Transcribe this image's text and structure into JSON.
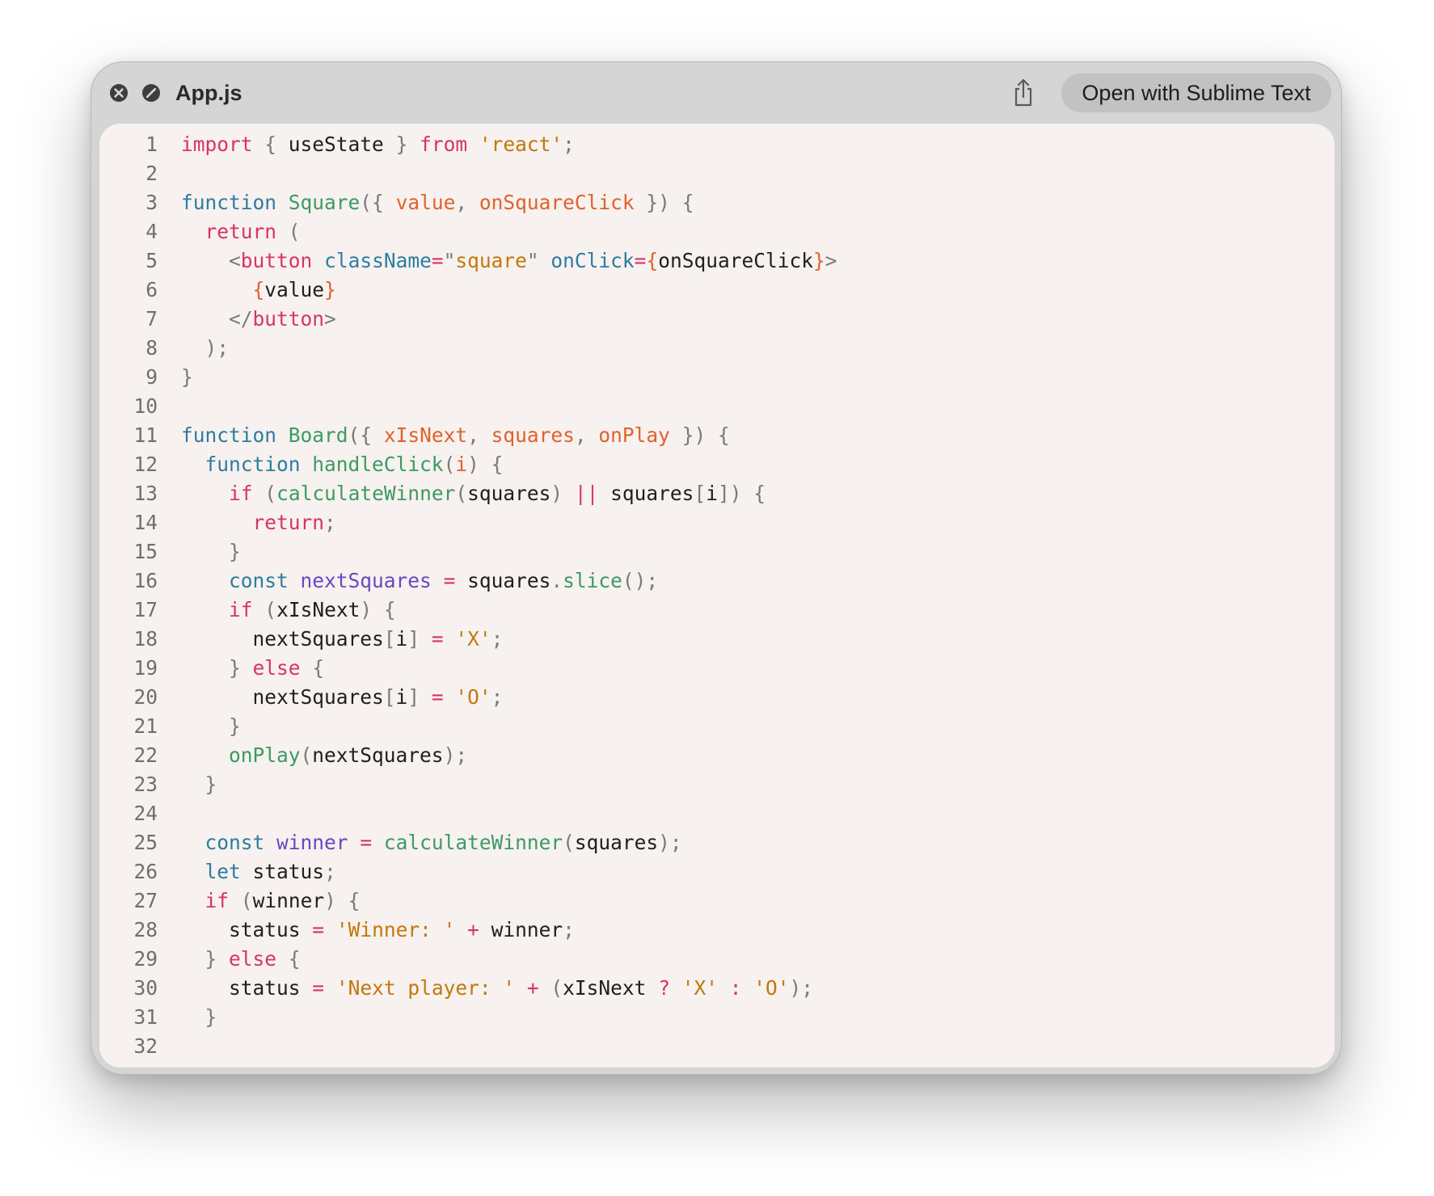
{
  "window": {
    "title": "App.js",
    "open_button_label": "Open with Sublime Text",
    "icons": {
      "close": "close-circle-icon",
      "stop": "stop-circle-icon",
      "share": "share-icon"
    }
  },
  "theme": {
    "titlebar": "#d5d5d5",
    "code_background": "#f7f1ef",
    "line_number": "#6f6f6f",
    "default_text": "#1f1f1f",
    "keyword": "#d6336c",
    "storage": "#2c7da0",
    "function_name": "#3b9b63",
    "parameter": "#e0622a",
    "string": "#c2780b",
    "punctuation": "#7a7a7a",
    "variable_declared": "#6a46c4"
  },
  "code": {
    "lines": [
      {
        "n": "1",
        "tokens": [
          [
            "import",
            "kw"
          ],
          [
            " ",
            "d"
          ],
          [
            "{",
            "p"
          ],
          [
            " useState ",
            "d"
          ],
          [
            "}",
            "p"
          ],
          [
            " ",
            "d"
          ],
          [
            "from",
            "kw"
          ],
          [
            " ",
            "d"
          ],
          [
            "'react'",
            "str"
          ],
          [
            ";",
            "p"
          ]
        ]
      },
      {
        "n": "2",
        "tokens": []
      },
      {
        "n": "3",
        "tokens": [
          [
            "function",
            "st"
          ],
          [
            " ",
            "d"
          ],
          [
            "Square",
            "fn"
          ],
          [
            "({",
            "p"
          ],
          [
            " ",
            "d"
          ],
          [
            "value",
            "par"
          ],
          [
            ",",
            "p"
          ],
          [
            " ",
            "d"
          ],
          [
            "onSquareClick",
            "par"
          ],
          [
            " ",
            "d"
          ],
          [
            "})",
            "p"
          ],
          [
            " ",
            "d"
          ],
          [
            "{",
            "p"
          ]
        ]
      },
      {
        "n": "4",
        "tokens": [
          [
            "  ",
            "d"
          ],
          [
            "return",
            "kw"
          ],
          [
            " ",
            "d"
          ],
          [
            "(",
            "p"
          ]
        ]
      },
      {
        "n": "5",
        "tokens": [
          [
            "    ",
            "d"
          ],
          [
            "<",
            "p"
          ],
          [
            "button",
            "kw"
          ],
          [
            " ",
            "d"
          ],
          [
            "className",
            "st"
          ],
          [
            "=",
            "kw"
          ],
          [
            "\"",
            "p"
          ],
          [
            "square",
            "str"
          ],
          [
            "\"",
            "p"
          ],
          [
            " ",
            "d"
          ],
          [
            "onClick",
            "st"
          ],
          [
            "=",
            "kw"
          ],
          [
            "{",
            "par"
          ],
          [
            "onSquareClick",
            "d"
          ],
          [
            "}",
            "par"
          ],
          [
            ">",
            "p"
          ]
        ]
      },
      {
        "n": "6",
        "tokens": [
          [
            "      ",
            "d"
          ],
          [
            "{",
            "par"
          ],
          [
            "value",
            "d"
          ],
          [
            "}",
            "par"
          ]
        ]
      },
      {
        "n": "7",
        "tokens": [
          [
            "    ",
            "d"
          ],
          [
            "</",
            "p"
          ],
          [
            "button",
            "kw"
          ],
          [
            ">",
            "p"
          ]
        ]
      },
      {
        "n": "8",
        "tokens": [
          [
            "  ",
            "d"
          ],
          [
            ");",
            "p"
          ]
        ]
      },
      {
        "n": "9",
        "tokens": [
          [
            "}",
            "p"
          ]
        ]
      },
      {
        "n": "10",
        "tokens": []
      },
      {
        "n": "11",
        "tokens": [
          [
            "function",
            "st"
          ],
          [
            " ",
            "d"
          ],
          [
            "Board",
            "fn"
          ],
          [
            "({",
            "p"
          ],
          [
            " ",
            "d"
          ],
          [
            "xIsNext",
            "par"
          ],
          [
            ",",
            "p"
          ],
          [
            " ",
            "d"
          ],
          [
            "squares",
            "par"
          ],
          [
            ",",
            "p"
          ],
          [
            " ",
            "d"
          ],
          [
            "onPlay",
            "par"
          ],
          [
            " ",
            "d"
          ],
          [
            "})",
            "p"
          ],
          [
            " ",
            "d"
          ],
          [
            "{",
            "p"
          ]
        ]
      },
      {
        "n": "12",
        "tokens": [
          [
            "  ",
            "d"
          ],
          [
            "function",
            "st"
          ],
          [
            " ",
            "d"
          ],
          [
            "handleClick",
            "fn"
          ],
          [
            "(",
            "p"
          ],
          [
            "i",
            "par"
          ],
          [
            ")",
            "p"
          ],
          [
            " ",
            "d"
          ],
          [
            "{",
            "p"
          ]
        ]
      },
      {
        "n": "13",
        "tokens": [
          [
            "    ",
            "d"
          ],
          [
            "if",
            "kw"
          ],
          [
            " ",
            "d"
          ],
          [
            "(",
            "p"
          ],
          [
            "calculateWinner",
            "fn"
          ],
          [
            "(",
            "p"
          ],
          [
            "squares",
            "d"
          ],
          [
            ")",
            "p"
          ],
          [
            " ",
            "d"
          ],
          [
            "||",
            "kw"
          ],
          [
            " ",
            "d"
          ],
          [
            "squares",
            "d"
          ],
          [
            "[",
            "p"
          ],
          [
            "i",
            "d"
          ],
          [
            "])",
            "p"
          ],
          [
            " ",
            "d"
          ],
          [
            "{",
            "p"
          ]
        ]
      },
      {
        "n": "14",
        "tokens": [
          [
            "      ",
            "d"
          ],
          [
            "return",
            "kw"
          ],
          [
            ";",
            "p"
          ]
        ]
      },
      {
        "n": "15",
        "tokens": [
          [
            "    ",
            "d"
          ],
          [
            "}",
            "p"
          ]
        ]
      },
      {
        "n": "16",
        "tokens": [
          [
            "    ",
            "d"
          ],
          [
            "const",
            "st"
          ],
          [
            " ",
            "d"
          ],
          [
            "nextSquares",
            "var"
          ],
          [
            " ",
            "d"
          ],
          [
            "=",
            "kw"
          ],
          [
            " ",
            "d"
          ],
          [
            "squares",
            "d"
          ],
          [
            ".",
            "p"
          ],
          [
            "slice",
            "fn"
          ],
          [
            "();",
            "p"
          ]
        ]
      },
      {
        "n": "17",
        "tokens": [
          [
            "    ",
            "d"
          ],
          [
            "if",
            "kw"
          ],
          [
            " ",
            "d"
          ],
          [
            "(",
            "p"
          ],
          [
            "xIsNext",
            "d"
          ],
          [
            ")",
            "p"
          ],
          [
            " ",
            "d"
          ],
          [
            "{",
            "p"
          ]
        ]
      },
      {
        "n": "18",
        "tokens": [
          [
            "      ",
            "d"
          ],
          [
            "nextSquares",
            "d"
          ],
          [
            "[",
            "p"
          ],
          [
            "i",
            "d"
          ],
          [
            "]",
            "p"
          ],
          [
            " ",
            "d"
          ],
          [
            "=",
            "kw"
          ],
          [
            " ",
            "d"
          ],
          [
            "'X'",
            "str"
          ],
          [
            ";",
            "p"
          ]
        ]
      },
      {
        "n": "19",
        "tokens": [
          [
            "    ",
            "d"
          ],
          [
            "}",
            "p"
          ],
          [
            " ",
            "d"
          ],
          [
            "else",
            "kw"
          ],
          [
            " ",
            "d"
          ],
          [
            "{",
            "p"
          ]
        ]
      },
      {
        "n": "20",
        "tokens": [
          [
            "      ",
            "d"
          ],
          [
            "nextSquares",
            "d"
          ],
          [
            "[",
            "p"
          ],
          [
            "i",
            "d"
          ],
          [
            "]",
            "p"
          ],
          [
            " ",
            "d"
          ],
          [
            "=",
            "kw"
          ],
          [
            " ",
            "d"
          ],
          [
            "'O'",
            "str"
          ],
          [
            ";",
            "p"
          ]
        ]
      },
      {
        "n": "21",
        "tokens": [
          [
            "    ",
            "d"
          ],
          [
            "}",
            "p"
          ]
        ]
      },
      {
        "n": "22",
        "tokens": [
          [
            "    ",
            "d"
          ],
          [
            "onPlay",
            "fn"
          ],
          [
            "(",
            "p"
          ],
          [
            "nextSquares",
            "d"
          ],
          [
            ");",
            "p"
          ]
        ]
      },
      {
        "n": "23",
        "tokens": [
          [
            "  ",
            "d"
          ],
          [
            "}",
            "p"
          ]
        ]
      },
      {
        "n": "24",
        "tokens": []
      },
      {
        "n": "25",
        "tokens": [
          [
            "  ",
            "d"
          ],
          [
            "const",
            "st"
          ],
          [
            " ",
            "d"
          ],
          [
            "winner",
            "var"
          ],
          [
            " ",
            "d"
          ],
          [
            "=",
            "kw"
          ],
          [
            " ",
            "d"
          ],
          [
            "calculateWinner",
            "fn"
          ],
          [
            "(",
            "p"
          ],
          [
            "squares",
            "d"
          ],
          [
            ");",
            "p"
          ]
        ]
      },
      {
        "n": "26",
        "tokens": [
          [
            "  ",
            "d"
          ],
          [
            "let",
            "st"
          ],
          [
            " ",
            "d"
          ],
          [
            "status",
            "d"
          ],
          [
            ";",
            "p"
          ]
        ]
      },
      {
        "n": "27",
        "tokens": [
          [
            "  ",
            "d"
          ],
          [
            "if",
            "kw"
          ],
          [
            " ",
            "d"
          ],
          [
            "(",
            "p"
          ],
          [
            "winner",
            "d"
          ],
          [
            ")",
            "p"
          ],
          [
            " ",
            "d"
          ],
          [
            "{",
            "p"
          ]
        ]
      },
      {
        "n": "28",
        "tokens": [
          [
            "    ",
            "d"
          ],
          [
            "status",
            "d"
          ],
          [
            " ",
            "d"
          ],
          [
            "=",
            "kw"
          ],
          [
            " ",
            "d"
          ],
          [
            "'Winner: '",
            "str"
          ],
          [
            " ",
            "d"
          ],
          [
            "+",
            "kw"
          ],
          [
            " ",
            "d"
          ],
          [
            "winner",
            "d"
          ],
          [
            ";",
            "p"
          ]
        ]
      },
      {
        "n": "29",
        "tokens": [
          [
            "  ",
            "d"
          ],
          [
            "}",
            "p"
          ],
          [
            " ",
            "d"
          ],
          [
            "else",
            "kw"
          ],
          [
            " ",
            "d"
          ],
          [
            "{",
            "p"
          ]
        ]
      },
      {
        "n": "30",
        "tokens": [
          [
            "    ",
            "d"
          ],
          [
            "status",
            "d"
          ],
          [
            " ",
            "d"
          ],
          [
            "=",
            "kw"
          ],
          [
            " ",
            "d"
          ],
          [
            "'Next player: '",
            "str"
          ],
          [
            " ",
            "d"
          ],
          [
            "+",
            "kw"
          ],
          [
            " ",
            "d"
          ],
          [
            "(",
            "p"
          ],
          [
            "xIsNext",
            "d"
          ],
          [
            " ",
            "d"
          ],
          [
            "?",
            "kw"
          ],
          [
            " ",
            "d"
          ],
          [
            "'X'",
            "str"
          ],
          [
            " ",
            "d"
          ],
          [
            ":",
            "kw"
          ],
          [
            " ",
            "d"
          ],
          [
            "'O'",
            "str"
          ],
          [
            ");",
            "p"
          ]
        ]
      },
      {
        "n": "31",
        "tokens": [
          [
            "  ",
            "d"
          ],
          [
            "}",
            "p"
          ]
        ]
      },
      {
        "n": "32",
        "tokens": []
      }
    ]
  }
}
